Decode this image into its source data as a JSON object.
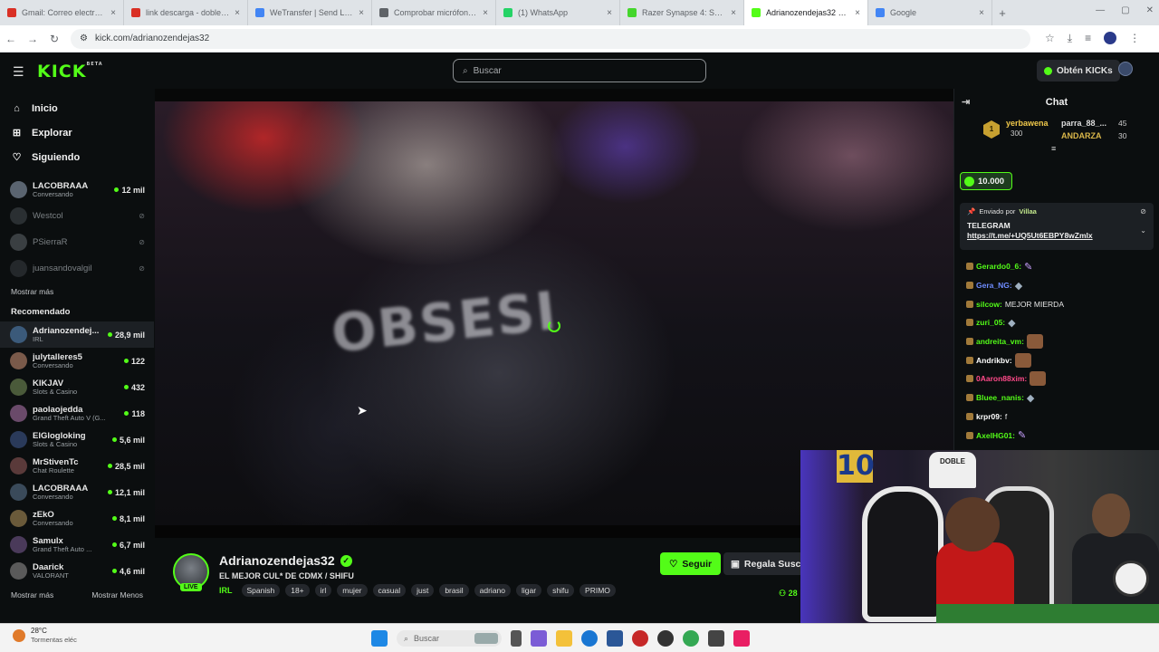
{
  "browser": {
    "tabs": [
      {
        "title": "Gmail: Correo electrónico",
        "color": "#d93025",
        "active": false
      },
      {
        "title": "link descarga - doblepivi",
        "color": "#d93025",
        "active": false
      },
      {
        "title": "WeTransfer | Send Large",
        "color": "#4285f4",
        "active": false
      },
      {
        "title": "Comprobar micrófono | M",
        "color": "#5f6368",
        "active": false
      },
      {
        "title": "(1) WhatsApp",
        "color": "#25d366",
        "active": false
      },
      {
        "title": "Razer Synapse 4: Softwa",
        "color": "#44d62c",
        "active": false
      },
      {
        "title": "Adrianozendejas32 Strea",
        "color": "#53fc18",
        "active": true
      },
      {
        "title": "Google",
        "color": "#4285f4",
        "active": false
      }
    ],
    "new_tab": "+",
    "url": "kick.com/adrianozendejas32"
  },
  "header": {
    "logo": "KICK",
    "logo_badge": "BETA",
    "search_placeholder": "Buscar",
    "get_kicks": "Obtén KICKs"
  },
  "sidebar": {
    "nav": [
      {
        "label": "Inicio",
        "icon": "home-icon",
        "glyph": "⌂"
      },
      {
        "label": "Explorar",
        "icon": "compass-icon",
        "glyph": "⊞"
      },
      {
        "label": "Siguiendo",
        "icon": "heart-icon",
        "glyph": "♡"
      }
    ],
    "following": [
      {
        "name": "LACOBRAAA",
        "category": "Conversando",
        "viewers": "12 mil",
        "live": true
      },
      {
        "name": "Westcol",
        "category": "",
        "viewers": "",
        "live": false
      },
      {
        "name": "PSierraR",
        "category": "",
        "viewers": "",
        "live": false
      },
      {
        "name": "juansandovalgil",
        "category": "",
        "viewers": "",
        "live": false
      }
    ],
    "show_more": "Mostrar más",
    "recommended_title": "Recomendado",
    "recommended": [
      {
        "name": "Adrianozendej...",
        "category": "IRL",
        "viewers": "28,9 mil"
      },
      {
        "name": "julytalleres5",
        "category": "Conversando",
        "viewers": "122"
      },
      {
        "name": "KIKJAV",
        "category": "Slots & Casino",
        "viewers": "432"
      },
      {
        "name": "paolaojedda",
        "category": "Grand Theft Auto V (G...",
        "viewers": "118"
      },
      {
        "name": "ElGlogloking",
        "category": "Slots & Casino",
        "viewers": "5,6 mil"
      },
      {
        "name": "MrStivenTc",
        "category": "Chat Roulette",
        "viewers": "28,5 mil"
      },
      {
        "name": "LACOBRAAA",
        "category": "Conversando",
        "viewers": "12,1 mil"
      },
      {
        "name": "zEkO",
        "category": "Conversando",
        "viewers": "8,1 mil"
      },
      {
        "name": "Samulx",
        "category": "Grand Theft Auto ...",
        "viewers": "6,7 mil"
      },
      {
        "name": "Daarick",
        "category": "VALORANT",
        "viewers": "4,6 mil"
      }
    ],
    "show_more_2": "Mostrar más",
    "show_less": "Mostrar Menos"
  },
  "video": {
    "shirt_text": "OBSESI"
  },
  "stream": {
    "name": "Adrianozendejas32",
    "live_badge": "LIVE",
    "title": "EL MEJOR CUL* DE CDMX  / SHIFU",
    "category": "IRL",
    "tags": [
      "Spanish",
      "18+",
      "irl",
      "mujer",
      "casual",
      "just",
      "brasil",
      "adriano",
      "ligar",
      "shifu",
      "PRIMO"
    ],
    "follow": "Seguir",
    "gift": "Regala Susc",
    "viewers": "28"
  },
  "chat": {
    "title": "Chat",
    "leaderboard": {
      "first_rank": "1",
      "first_name": "yerbawena",
      "first_value": "300",
      "second_name": "parra_88_...",
      "second_value": "45",
      "third_name": "ANDARZA",
      "third_value": "30"
    },
    "kicks_chip": "10.000",
    "pinned": {
      "sent_by_label": "Enviado por",
      "sent_by": "Villaa",
      "message": "TELEGRAM",
      "link": "https://t.me/+UQ5Ut6EBPY8wZmlx"
    },
    "messages": [
      {
        "user": "Gerardo0_6:",
        "color": "#53fc18",
        "text": "",
        "emote": "emk"
      },
      {
        "user": "Gera_NG:",
        "color": "#6f8cff",
        "text": "",
        "emote": "emg"
      },
      {
        "user": "silcow:",
        "color": "#53fc18",
        "text": "MEJOR MIERDA",
        "emote": ""
      },
      {
        "user": "zuri_05:",
        "color": "#53fc18",
        "text": "",
        "emote": "emg"
      },
      {
        "user": "andreita_vm:",
        "color": "#53fc18",
        "text": "",
        "emote": "em"
      },
      {
        "user": "Andrikbv:",
        "color": "#ffffff",
        "text": "",
        "emote": "em"
      },
      {
        "user": "0Aaron88xim:",
        "color": "#ff4a8a",
        "text": "",
        "emote": "em"
      },
      {
        "user": "Bluee_nanis:",
        "color": "#53fc18",
        "text": "",
        "emote": "emg"
      },
      {
        "user": "krpr09:",
        "color": "#ffffff",
        "text": "f",
        "emote": ""
      },
      {
        "user": "AxelHG01:",
        "color": "#53fc18",
        "text": "",
        "emote": "emk"
      }
    ]
  },
  "webcam": {
    "jersey_number": "10",
    "poster": "DOBLE"
  },
  "taskbar": {
    "temp": "28°C",
    "weather": "Tormentas eléc",
    "search": "Buscar"
  }
}
